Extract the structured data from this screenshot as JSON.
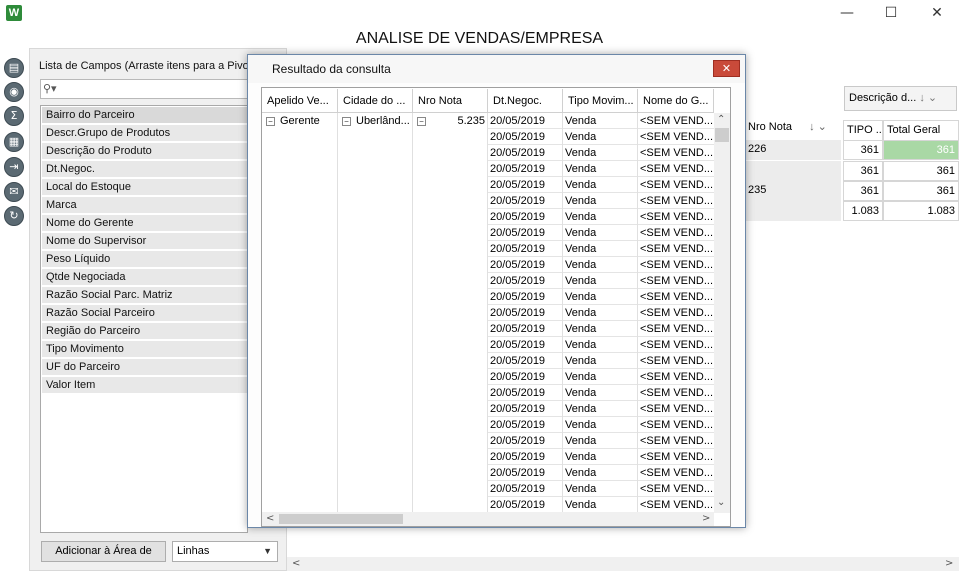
{
  "window": {
    "logo": "W",
    "title": "ANALISE DE VENDAS/EMPRESA",
    "minimize_glyph": "—",
    "maximize_glyph": "☐",
    "close_glyph": "✕"
  },
  "toolbar_icons": [
    "report-icon",
    "camera-icon",
    "sum-icon",
    "grid-icon",
    "export-icon",
    "email-icon",
    "refresh-icon"
  ],
  "field_list": {
    "title": "Lista de Campos (Arraste itens para a Pivot",
    "search_icon": "⚲▾",
    "items": [
      "Bairro do Parceiro",
      "Descr.Grupo de Produtos",
      "Descrição do Produto",
      "Dt.Negoc.",
      "Local do Estoque",
      "Marca",
      "Nome do Gerente",
      "Nome do Supervisor",
      "Peso Líquido",
      "Qtde Negociada",
      "Razão Social Parc. Matriz",
      "Razão Social Parceiro",
      "Região do Parceiro",
      "Tipo Movimento",
      "UF do Parceiro",
      "Valor Item"
    ],
    "add_button": "Adicionar à Área de",
    "area_select": "Linhas"
  },
  "pivot": {
    "desc_dropdown": "Descrição d...",
    "nro_nota_header": "Nro Nota",
    "tipo_header": "TIPO ...",
    "total_header": "Total Geral",
    "rows": [
      {
        "nota": "226",
        "tipo": "361",
        "total": "361"
      },
      {
        "nota": "",
        "tipo": "361",
        "total": "361"
      },
      {
        "nota": "235",
        "tipo": "361",
        "total": "361"
      },
      {
        "nota": "",
        "tipo": "1.083",
        "total": "1.083"
      }
    ],
    "highlight_color": "#a9d8a5"
  },
  "dialog": {
    "title": "Resultado da consulta",
    "close_glyph": "✕",
    "columns": [
      "Apelido Ve...",
      "Cidade do ...",
      "Nro Nota",
      "Dt.Negoc.",
      "Tipo Movim...",
      "Nome do G..."
    ],
    "first_row": {
      "apelido": "Gerente",
      "cidade": "Uberlând...",
      "nota": "5.235"
    },
    "row_date": "20/05/2019",
    "row_tipo": "Venda",
    "row_nome": "<SEM VEND...",
    "row_count": 25
  }
}
